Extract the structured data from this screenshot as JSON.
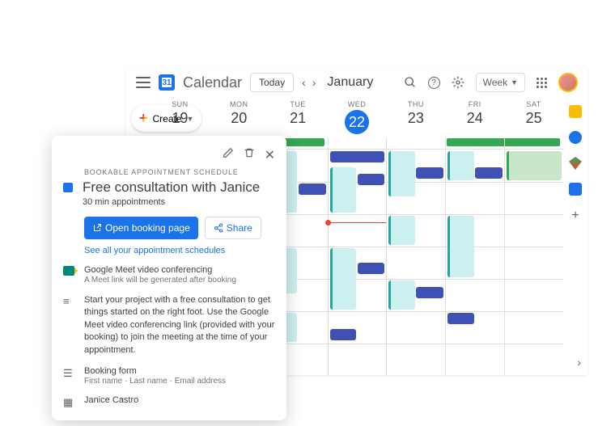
{
  "header": {
    "app_title": "Calendar",
    "today_label": "Today",
    "month_label": "January",
    "view_selector": "Week"
  },
  "create": {
    "label": "Create"
  },
  "mini_calendar": {
    "month": "January"
  },
  "days": [
    {
      "dow": "SUN",
      "num": "19"
    },
    {
      "dow": "MON",
      "num": "20"
    },
    {
      "dow": "TUE",
      "num": "21"
    },
    {
      "dow": "WED",
      "num": "22",
      "today": true
    },
    {
      "dow": "THU",
      "num": "23"
    },
    {
      "dow": "FRI",
      "num": "24"
    },
    {
      "dow": "SAT",
      "num": "25"
    }
  ],
  "popup": {
    "label": "BOOKABLE APPOINTMENT SCHEDULE",
    "title": "Free consultation with Janice",
    "subtitle": "30 min appointments",
    "open_btn": "Open booking page",
    "share_btn": "Share",
    "link": "See all your appointment schedules",
    "meet_title": "Google Meet video conferencing",
    "meet_sub": "A Meet link will be generated after booking",
    "desc": "Start your project with a free consultation to get things started on the right foot. Use the Google Meet video conferencing link (provided with your booking) to join the meeting at the time of your appointment.",
    "form_title": "Booking form",
    "form_sub": "First name · Last name · Email address",
    "organizer": "Janice Castro"
  }
}
